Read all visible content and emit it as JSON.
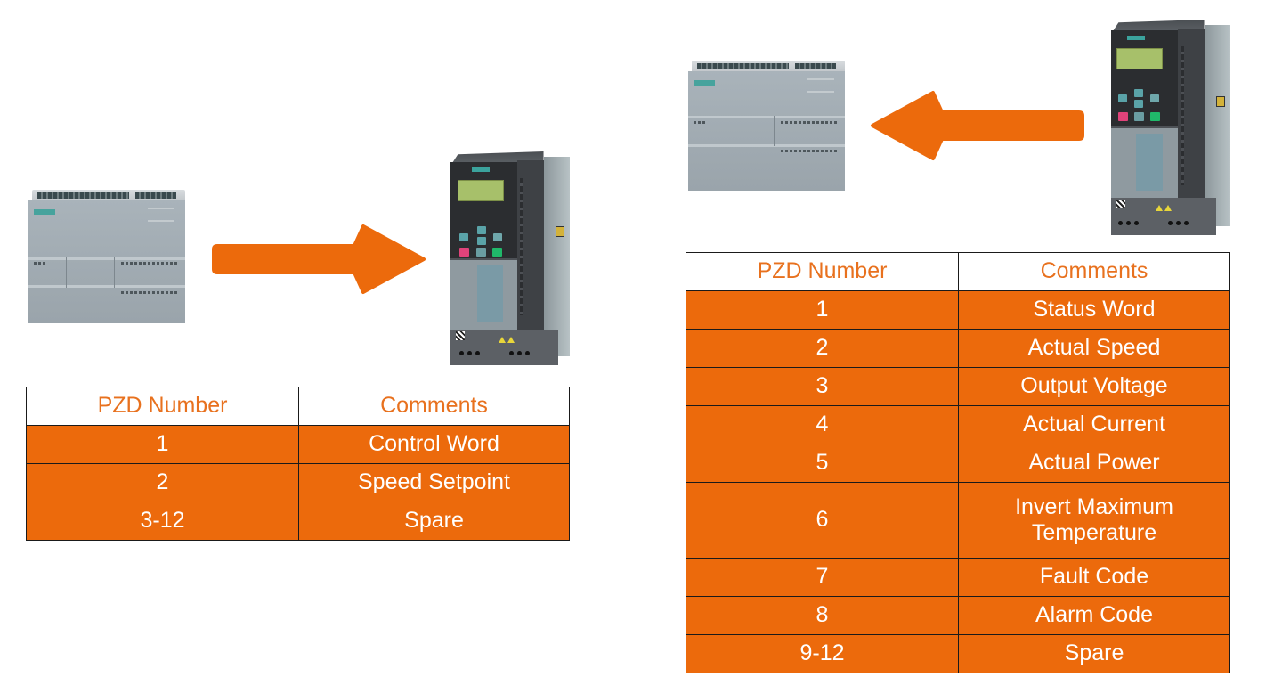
{
  "colors": {
    "accent_orange": "#ec6a0c",
    "header_text_orange": "#e8711e",
    "cell_text": "#ffffff",
    "border": "#1a1a1a",
    "plc_gray": "#a2acb3",
    "drive_dark": "#3e4145",
    "siemens_teal": "#47a39d"
  },
  "left_panel": {
    "direction": "PLC to Drive (Send)",
    "source_device": "plc-s7-1200",
    "target_device": "sinamics-g120-drive",
    "arrow": "right-arrow",
    "table": {
      "headers": [
        "PZD Number",
        "Comments"
      ],
      "rows": [
        {
          "pzd": "1",
          "comment": "Control Word"
        },
        {
          "pzd": "2",
          "comment": "Speed Setpoint"
        },
        {
          "pzd": "3-12",
          "comment": "Spare"
        }
      ]
    }
  },
  "right_panel": {
    "direction": "Drive to PLC (Receive)",
    "source_device": "sinamics-g120-drive",
    "target_device": "plc-s7-1200",
    "arrow": "left-arrow",
    "table": {
      "headers": [
        "PZD Number",
        "Comments"
      ],
      "rows": [
        {
          "pzd": "1",
          "comment": "Status Word"
        },
        {
          "pzd": "2",
          "comment": "Actual Speed"
        },
        {
          "pzd": "3",
          "comment": "Output Voltage"
        },
        {
          "pzd": "4",
          "comment": "Actual Current"
        },
        {
          "pzd": "5",
          "comment": "Actual Power"
        },
        {
          "pzd": "6",
          "comment_line1": "Invert Maximum",
          "comment_line2": "Temperature"
        },
        {
          "pzd": "7",
          "comment": "Fault Code"
        },
        {
          "pzd": "8",
          "comment": "Alarm Code"
        },
        {
          "pzd": "9-12",
          "comment": "Spare"
        }
      ]
    }
  }
}
